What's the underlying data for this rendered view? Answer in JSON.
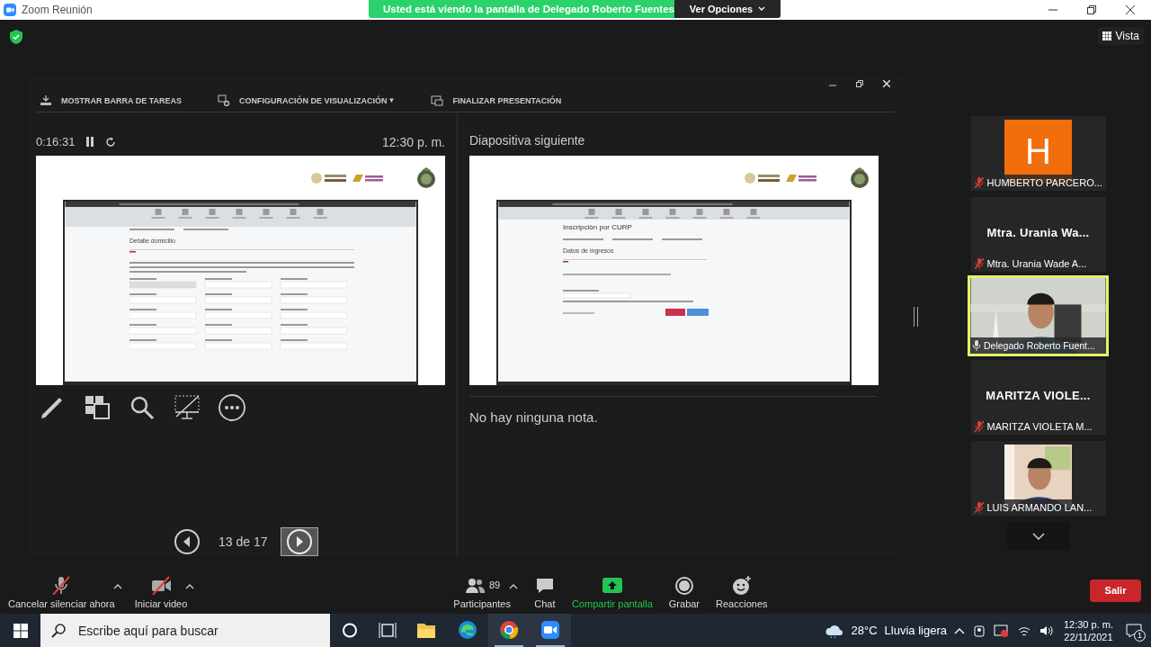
{
  "window": {
    "title": "Zoom Reunión"
  },
  "share_banner": {
    "text": "Usted está viendo la pantalla de Delegado Roberto Fuentes",
    "options_button": "Ver Opciones"
  },
  "view_button": "Vista",
  "presenter": {
    "toolbar": [
      {
        "kind": "taskbar",
        "label": "MOSTRAR BARRA DE TAREAS"
      },
      {
        "kind": "display",
        "label": "CONFIGURACIÓN DE VISUALIZACIÓN",
        "caret": "▼"
      },
      {
        "kind": "end",
        "label": "FINALIZAR PRESENTACIÓN"
      }
    ],
    "timer": "0:16:31",
    "clock": "12:30 p. m.",
    "current_slide": {
      "kind": "domicilio",
      "heading": "Detalle domicilio"
    },
    "next_label": "Diapositiva siguiente",
    "next_slide": {
      "kind": "curp",
      "title": "Inscripción por CURP",
      "heading": "Datos de ingresos"
    },
    "notes": "No hay ninguna nota.",
    "navigation": {
      "counter": "13 de 17",
      "next_hovered": true
    }
  },
  "gallery": [
    {
      "kind": "avatar",
      "letter": "H",
      "label": "HUMBERTO PARCERO...",
      "muted": true,
      "speaking": false
    },
    {
      "kind": "name",
      "display_name": "Mtra. Urania Wa...",
      "label": "Mtra. Urania Wade A...",
      "muted": true,
      "speaking": false
    },
    {
      "kind": "video",
      "label": "Delegado Roberto Fuent...",
      "muted": false,
      "speaking": true
    },
    {
      "kind": "name",
      "display_name": "MARITZA VIOLE...",
      "label": "MARITZA VIOLETA M...",
      "muted": true,
      "speaking": false
    },
    {
      "kind": "portrait",
      "label": "LUIS ARMANDO LAN...",
      "muted": true,
      "speaking": false
    }
  ],
  "toolbar": [
    {
      "kind": "mic",
      "label": "Cancelar silenciar ahora",
      "off": true
    },
    {
      "kind": "video",
      "label": "Iniciar video",
      "off": true
    },
    {
      "kind": "participants",
      "label": "Participantes",
      "count": "89"
    },
    {
      "kind": "chat",
      "label": "Chat"
    },
    {
      "kind": "share",
      "label": "Compartir pantalla"
    },
    {
      "kind": "record",
      "label": "Grabar"
    },
    {
      "kind": "reactions",
      "label": "Reacciones"
    }
  ],
  "leave_button": "Salir",
  "taskbar": {
    "search_placeholder": "Escribe aquí para buscar",
    "apps": [
      {
        "kind": "explorer",
        "running": false
      },
      {
        "kind": "edge",
        "running": false
      },
      {
        "kind": "chrome",
        "running": true
      },
      {
        "kind": "zoom",
        "running": true
      }
    ],
    "weather": {
      "temperature": "28°C",
      "condition": "Lluvia ligera"
    },
    "time": "12:30 p. m.",
    "date": "22/11/2021",
    "notifications": "1"
  }
}
